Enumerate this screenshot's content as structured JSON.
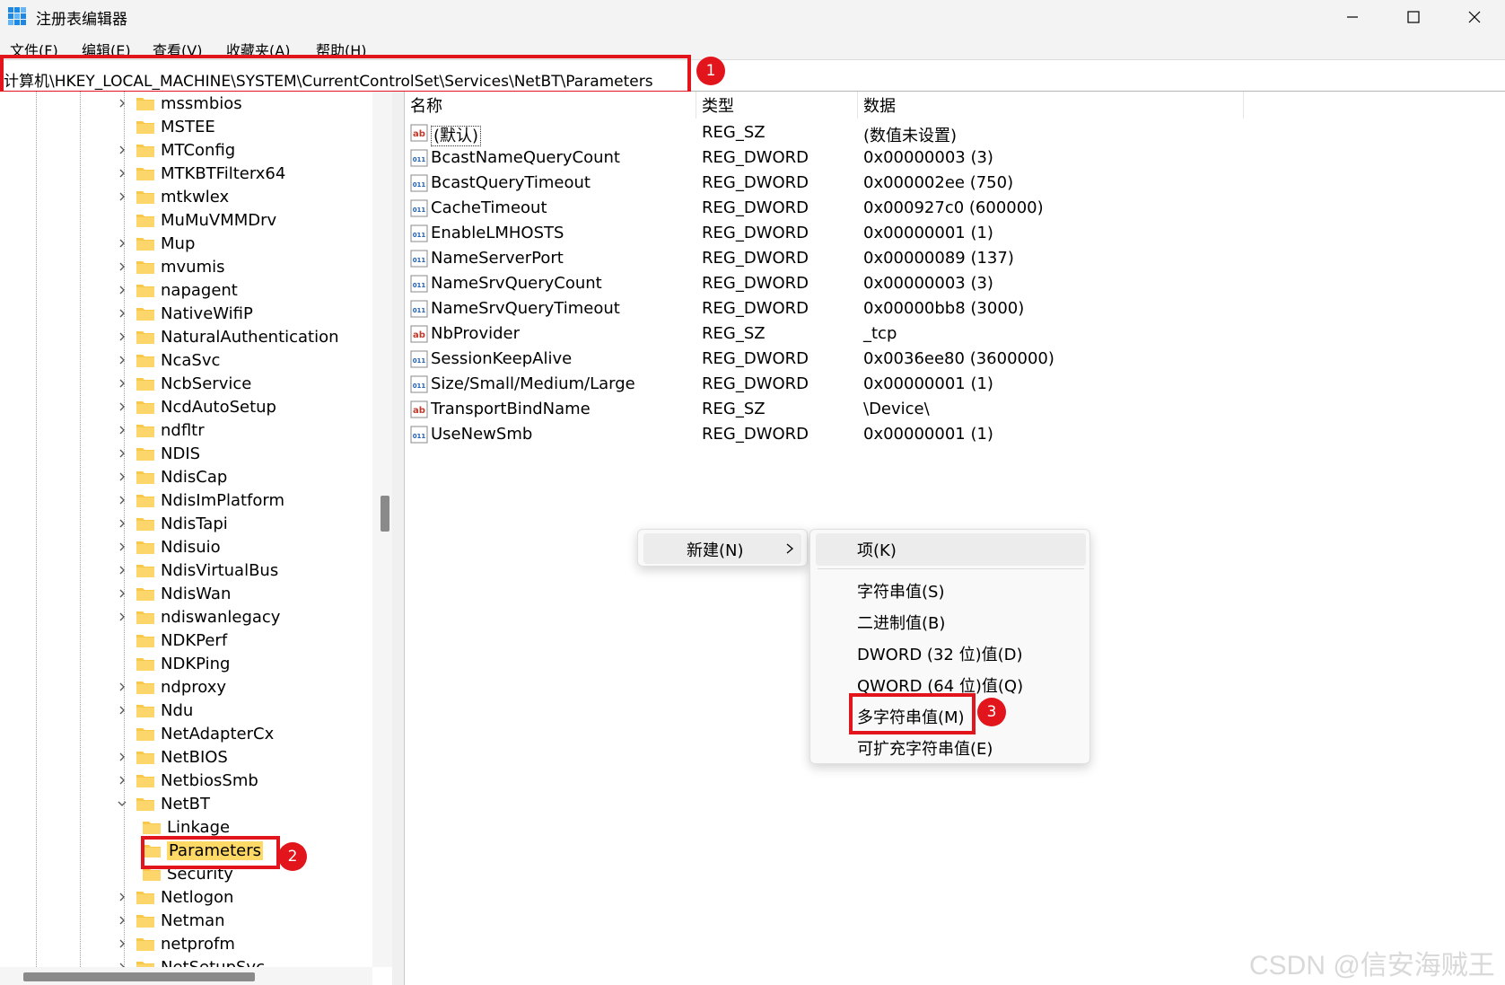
{
  "window": {
    "title": "注册表编辑器"
  },
  "menubar": [
    "文件(F)",
    "编辑(E)",
    "查看(V)",
    "收藏夹(A)",
    "帮助(H)"
  ],
  "address": "计算机\\HKEY_LOCAL_MACHINE\\SYSTEM\\CurrentControlSet\\Services\\NetBT\\Parameters",
  "badges": [
    "1",
    "2",
    "3"
  ],
  "tree": [
    {
      "label": "mssmbios",
      "chevron": "right"
    },
    {
      "label": "MSTEE",
      "chevron": "none"
    },
    {
      "label": "MTConfig",
      "chevron": "right"
    },
    {
      "label": "MTKBTFilterx64",
      "chevron": "right"
    },
    {
      "label": "mtkwlex",
      "chevron": "right"
    },
    {
      "label": "MuMuVMMDrv",
      "chevron": "none"
    },
    {
      "label": "Mup",
      "chevron": "right"
    },
    {
      "label": "mvumis",
      "chevron": "right"
    },
    {
      "label": "napagent",
      "chevron": "right"
    },
    {
      "label": "NativeWifiP",
      "chevron": "right"
    },
    {
      "label": "NaturalAuthentication",
      "chevron": "right"
    },
    {
      "label": "NcaSvc",
      "chevron": "right"
    },
    {
      "label": "NcbService",
      "chevron": "right"
    },
    {
      "label": "NcdAutoSetup",
      "chevron": "right"
    },
    {
      "label": "ndfltr",
      "chevron": "right"
    },
    {
      "label": "NDIS",
      "chevron": "right"
    },
    {
      "label": "NdisCap",
      "chevron": "right"
    },
    {
      "label": "NdisImPlatform",
      "chevron": "right"
    },
    {
      "label": "NdisTapi",
      "chevron": "right"
    },
    {
      "label": "Ndisuio",
      "chevron": "right"
    },
    {
      "label": "NdisVirtualBus",
      "chevron": "right"
    },
    {
      "label": "NdisWan",
      "chevron": "right"
    },
    {
      "label": "ndiswanlegacy",
      "chevron": "right"
    },
    {
      "label": "NDKPerf",
      "chevron": "none"
    },
    {
      "label": "NDKPing",
      "chevron": "none"
    },
    {
      "label": "ndproxy",
      "chevron": "right"
    },
    {
      "label": "Ndu",
      "chevron": "right"
    },
    {
      "label": "NetAdapterCx",
      "chevron": "none"
    },
    {
      "label": "NetBIOS",
      "chevron": "right"
    },
    {
      "label": "NetbiosSmb",
      "chevron": "right"
    },
    {
      "label": "NetBT",
      "chevron": "down"
    },
    {
      "label": "Linkage",
      "chevron": "none",
      "child": true
    },
    {
      "label": "Parameters",
      "chevron": "none",
      "child": true,
      "selected": true
    },
    {
      "label": "Security",
      "chevron": "none",
      "child": true
    },
    {
      "label": "Netlogon",
      "chevron": "right"
    },
    {
      "label": "Netman",
      "chevron": "right"
    },
    {
      "label": "netprofm",
      "chevron": "right"
    },
    {
      "label": "NetSetupSvc",
      "chevron": "right"
    }
  ],
  "list": {
    "headers": [
      "名称",
      "类型",
      "数据"
    ],
    "rows": [
      {
        "name": "(默认)",
        "type": "REG_SZ",
        "data": "(数值未设置)",
        "icon": "string-value-icon"
      },
      {
        "name": "BcastNameQueryCount",
        "type": "REG_DWORD",
        "data": "0x00000003 (3)",
        "icon": "binary-value-icon"
      },
      {
        "name": "BcastQueryTimeout",
        "type": "REG_DWORD",
        "data": "0x000002ee (750)",
        "icon": "binary-value-icon"
      },
      {
        "name": "CacheTimeout",
        "type": "REG_DWORD",
        "data": "0x000927c0 (600000)",
        "icon": "binary-value-icon"
      },
      {
        "name": "EnableLMHOSTS",
        "type": "REG_DWORD",
        "data": "0x00000001 (1)",
        "icon": "binary-value-icon"
      },
      {
        "name": "NameServerPort",
        "type": "REG_DWORD",
        "data": "0x00000089 (137)",
        "icon": "binary-value-icon"
      },
      {
        "name": "NameSrvQueryCount",
        "type": "REG_DWORD",
        "data": "0x00000003 (3)",
        "icon": "binary-value-icon"
      },
      {
        "name": "NameSrvQueryTimeout",
        "type": "REG_DWORD",
        "data": "0x00000bb8 (3000)",
        "icon": "binary-value-icon"
      },
      {
        "name": "NbProvider",
        "type": "REG_SZ",
        "data": "_tcp",
        "icon": "string-value-icon"
      },
      {
        "name": "SessionKeepAlive",
        "type": "REG_DWORD",
        "data": "0x0036ee80 (3600000)",
        "icon": "binary-value-icon"
      },
      {
        "name": "Size/Small/Medium/Large",
        "type": "REG_DWORD",
        "data": "0x00000001 (1)",
        "icon": "binary-value-icon"
      },
      {
        "name": "TransportBindName",
        "type": "REG_SZ",
        "data": "\\Device\\",
        "icon": "string-value-icon"
      },
      {
        "name": "UseNewSmb",
        "type": "REG_DWORD",
        "data": "0x00000001 (1)",
        "icon": "binary-value-icon"
      }
    ]
  },
  "context_menu": {
    "new_label": "新建(N)",
    "submenu": [
      "项(K)",
      "字符串值(S)",
      "二进制值(B)",
      "DWORD (32 位)值(D)",
      "QWORD (64 位)值(Q)",
      "多字符串值(M)",
      "可扩充字符串值(E)"
    ]
  },
  "watermark": "CSDN @信安海贼王",
  "colors": {
    "highlight": "#e3151c",
    "folder": "#f8c84a",
    "selection": "#ffd966"
  }
}
